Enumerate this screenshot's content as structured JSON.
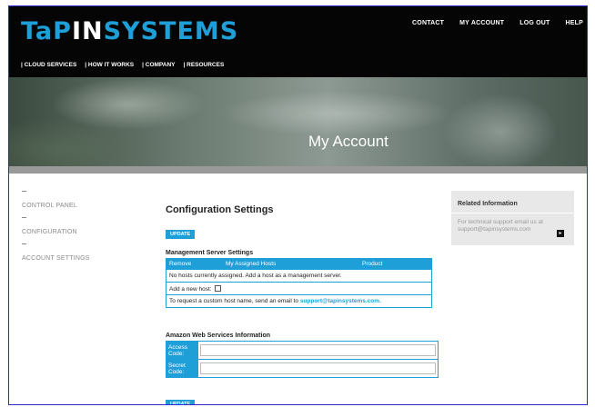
{
  "brand": {
    "logo_part1": "TaP",
    "logo_part2": "IN",
    "logo_part3": "SYSTEMS"
  },
  "top_nav": [
    "CONTACT",
    "MY ACCOUNT",
    "LOG OUT",
    "HELP"
  ],
  "main_nav": [
    "CLOUD SERVICES",
    "HOW IT WORKS",
    "COMPANY",
    "RESOURCES"
  ],
  "hero": {
    "title": "My Account"
  },
  "sidebar": {
    "items": [
      {
        "label": "CONTROL PANEL"
      },
      {
        "label": "CONFIGURATION"
      },
      {
        "label": "ACCOUNT SETTINGS"
      }
    ]
  },
  "config": {
    "title": "Configuration Settings",
    "update_label": "UPDATE",
    "management": {
      "title": "Management Server Settings",
      "headers": [
        "Remove",
        "My Assigned Hosts",
        "Product"
      ],
      "empty_message": "No hosts currently assigned. Add a host as a management server.",
      "add_host_label": "Add a new host:",
      "custom_host_prefix": "To request a custom host name, send an email to ",
      "support_email": "support@tapinsystems.com",
      "custom_host_suffix": "."
    },
    "aws": {
      "title": "Amazon Web Services Information",
      "access_code_label": "Access Code:",
      "secret_code_label": "Secret Code:",
      "access_code_value": "",
      "secret_code_value": ""
    }
  },
  "related": {
    "title": "Related Information",
    "text": "For technical support email us at support@tapinsystems.com"
  },
  "colors": {
    "accent": "#1e9fd8",
    "header_bg": "#050505"
  }
}
